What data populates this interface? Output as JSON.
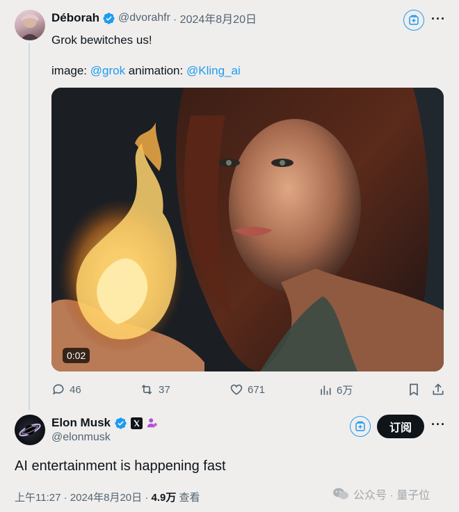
{
  "tweet": {
    "author_name": "Déborah",
    "author_handle": "@dvorahfr",
    "date": "· 2024年8月20日",
    "text": "Grok bewitches us!",
    "credit_prefix": "image: ",
    "credit_grok": "@grok",
    "credit_middle": " animation: ",
    "credit_kling": "@Kling_ai",
    "video_time": "0:02",
    "replies": "46",
    "retweets": "37",
    "likes": "671",
    "views": "6万"
  },
  "reply": {
    "author_name": "Elon Musk",
    "author_handle": "@elonmusk",
    "subscribe_label": "订阅",
    "text": "AI entertainment is happening fast",
    "time": "上午11:27 · 2024年8月20日 · ",
    "views_count": "4.9万",
    "views_label": " 查看"
  },
  "watermark": {
    "text": "公众号 · 量子位"
  },
  "colors": {
    "accent": "#1d9bf0",
    "text": "#0f1419",
    "muted": "#536471",
    "background": "#efeeed"
  },
  "icons": {
    "verified": "verified-badge-icon",
    "grok_add": "grok-add-icon",
    "more": "more-icon",
    "reply": "reply-icon",
    "retweet": "retweet-icon",
    "like": "like-icon",
    "views": "views-icon",
    "bookmark": "bookmark-icon",
    "share": "share-icon",
    "x_logo": "x-logo-icon",
    "affiliate": "affiliate-icon"
  }
}
